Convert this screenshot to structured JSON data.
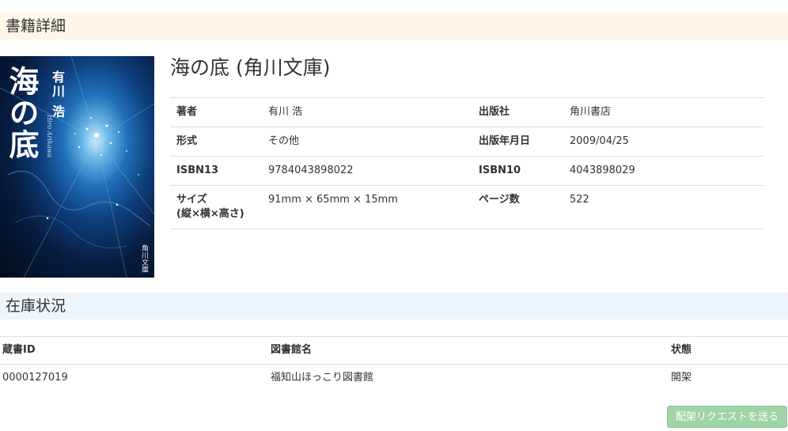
{
  "detail_section": {
    "title": "書籍詳細"
  },
  "book": {
    "title": "海の底 (角川文庫)",
    "cover": {
      "title_text": "海の底",
      "author_text": "有川 浩",
      "author_roman": "Hiro Arikawa",
      "publisher_text": "角川文庫"
    },
    "fields": {
      "author_label": "著者",
      "author_value": "有川 浩",
      "publisher_label": "出版社",
      "publisher_value": "角川書店",
      "format_label": "形式",
      "format_value": "その他",
      "pubdate_label": "出版年月日",
      "pubdate_value": "2009/04/25",
      "isbn13_label": "ISBN13",
      "isbn13_value": "9784043898022",
      "isbn10_label": "ISBN10",
      "isbn10_value": "4043898029",
      "size_label_line1": "サイズ",
      "size_label_line2": "(縦×横×高さ)",
      "size_value": "91mm × 65mm × 15mm",
      "pages_label": "ページ数",
      "pages_value": "522"
    }
  },
  "stock_section": {
    "title": "在庫状況",
    "columns": {
      "id": "蔵書ID",
      "library": "図書館名",
      "status": "状態"
    },
    "rows": [
      {
        "id": "0000127019",
        "library": "福知山ほっこり図書館",
        "status": "開架"
      }
    ],
    "request_button": "配架リクエストを送る"
  },
  "colors": {
    "detail_header_bg": "#fdf6e9",
    "stock_header_bg": "#eef6fd",
    "request_button_bg": "#9fd4a7"
  }
}
